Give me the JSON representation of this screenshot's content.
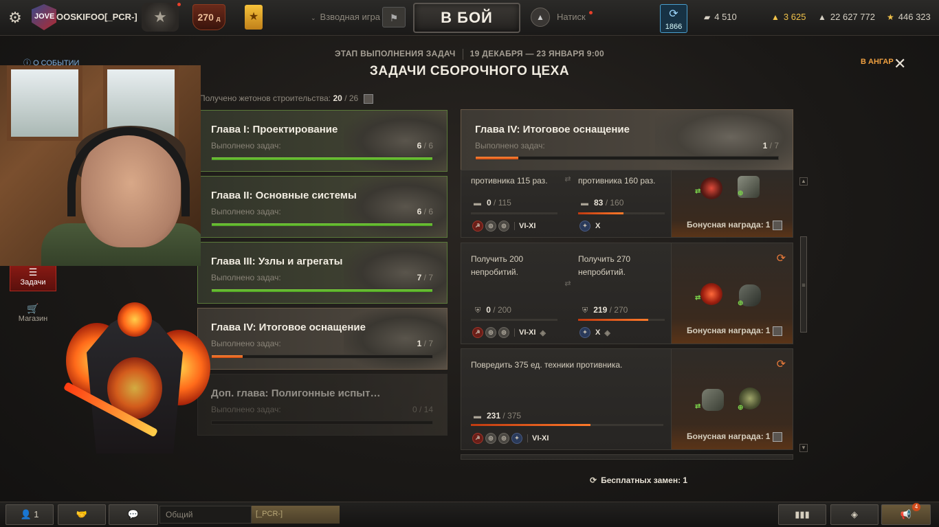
{
  "topbar": {
    "player_tag": "JOVE",
    "player_name": "OOSKIFOO[_PCR-]",
    "level": "270",
    "level_suffix": "д",
    "platoon_label": "Взводная игра",
    "battle_button": "В БОЙ",
    "mode_name": "Натиск",
    "premium_days": "1866",
    "currencies": [
      {
        "name": "crystals",
        "value": "4 510",
        "icon": "bond-icon"
      },
      {
        "name": "gold",
        "value": "3 625",
        "icon": "gold-icon"
      },
      {
        "name": "credits",
        "value": "22 627 772",
        "icon": "credits-icon"
      },
      {
        "name": "free_xp",
        "value": "446 323",
        "icon": "star-icon"
      }
    ]
  },
  "header": {
    "stage": "ЭТАП ВЫПОЛНЕНИЯ ЗАДАЧ",
    "dates": "19 ДЕКАБРЯ — 23 ЯНВАРЯ 9:00",
    "title": "ЗАДАЧИ СБОРОЧНОГО ЦЕХА",
    "to_hangar": "В АНГАР",
    "about_event": "О СОБЫТИИ",
    "tokens_label": "Получено жетонов строительства:",
    "tokens_done": "20",
    "tokens_total": "/ 26"
  },
  "nav": {
    "tasks": "Задачи",
    "shop": "Магазин"
  },
  "chapters": [
    {
      "title": "Глава I: Проектирование",
      "sub": "Выполнено задач:",
      "done": "6",
      "total": "/ 6",
      "progress": 1.0,
      "state": "done"
    },
    {
      "title": "Глава II: Основные системы",
      "sub": "Выполнено задач:",
      "done": "6",
      "total": "/ 6",
      "progress": 1.0,
      "state": "done"
    },
    {
      "title": "Глава III: Узлы и агрегаты",
      "sub": "Выполнено задач:",
      "done": "7",
      "total": "/ 7",
      "progress": 1.0,
      "state": "done"
    },
    {
      "title": "Глава IV: Итоговое оснащение",
      "sub": "Выполнено задач:",
      "done": "1",
      "total": "/ 7",
      "progress": 0.14,
      "state": "active"
    },
    {
      "title": "Доп. глава: Полигонные испыт…",
      "sub": "Выполнено задач:",
      "done": "0",
      "total": "/ 14",
      "progress": 0.0,
      "state": "locked"
    }
  ],
  "panel": {
    "title": "Глава IV: Итоговое оснащение",
    "sub": "Выполнено задач:",
    "done": "1",
    "total": "/ 7",
    "progress": 0.14
  },
  "tasks": [
    {
      "left_text": "противника 115 раз.",
      "right_text": "противника 160 раз.",
      "left_value": "0",
      "left_total": "/ 115",
      "left_progress": 0.0,
      "right_value": "83",
      "right_total": "/ 160",
      "right_progress": 0.52,
      "left_tier": "VI-XI",
      "right_tier": "X",
      "bonus": "Бонусная награда:",
      "bonus_count": "1"
    },
    {
      "left_text": "Получить 200 непробитий.",
      "right_text": "Получить 270 непробитий.",
      "left_value": "0",
      "left_total": "/ 200",
      "left_progress": 0.0,
      "right_value": "219",
      "right_total": "/ 270",
      "right_progress": 0.81,
      "left_tier": "VI-XI",
      "right_tier": "X",
      "bonus": "Бонусная награда:",
      "bonus_count": "1"
    },
    {
      "left_text": "Повредить 375 ед. техники противника.",
      "left_value": "231",
      "left_total": "/ 375",
      "left_progress": 0.62,
      "left_tier": "VI-XI",
      "bonus": "Бонусная награда:",
      "bonus_count": "1"
    }
  ],
  "free_swaps": "Бесплатных замен: 1",
  "bottombar": {
    "squad_count": "1",
    "chat_channel": "Общий",
    "clan_tag": "[_PCR-]",
    "notif_count": "4"
  },
  "colors": {
    "accent_orange": "#ff7a2a",
    "progress_green": "#6cc033",
    "gold": "#f1c24a"
  }
}
